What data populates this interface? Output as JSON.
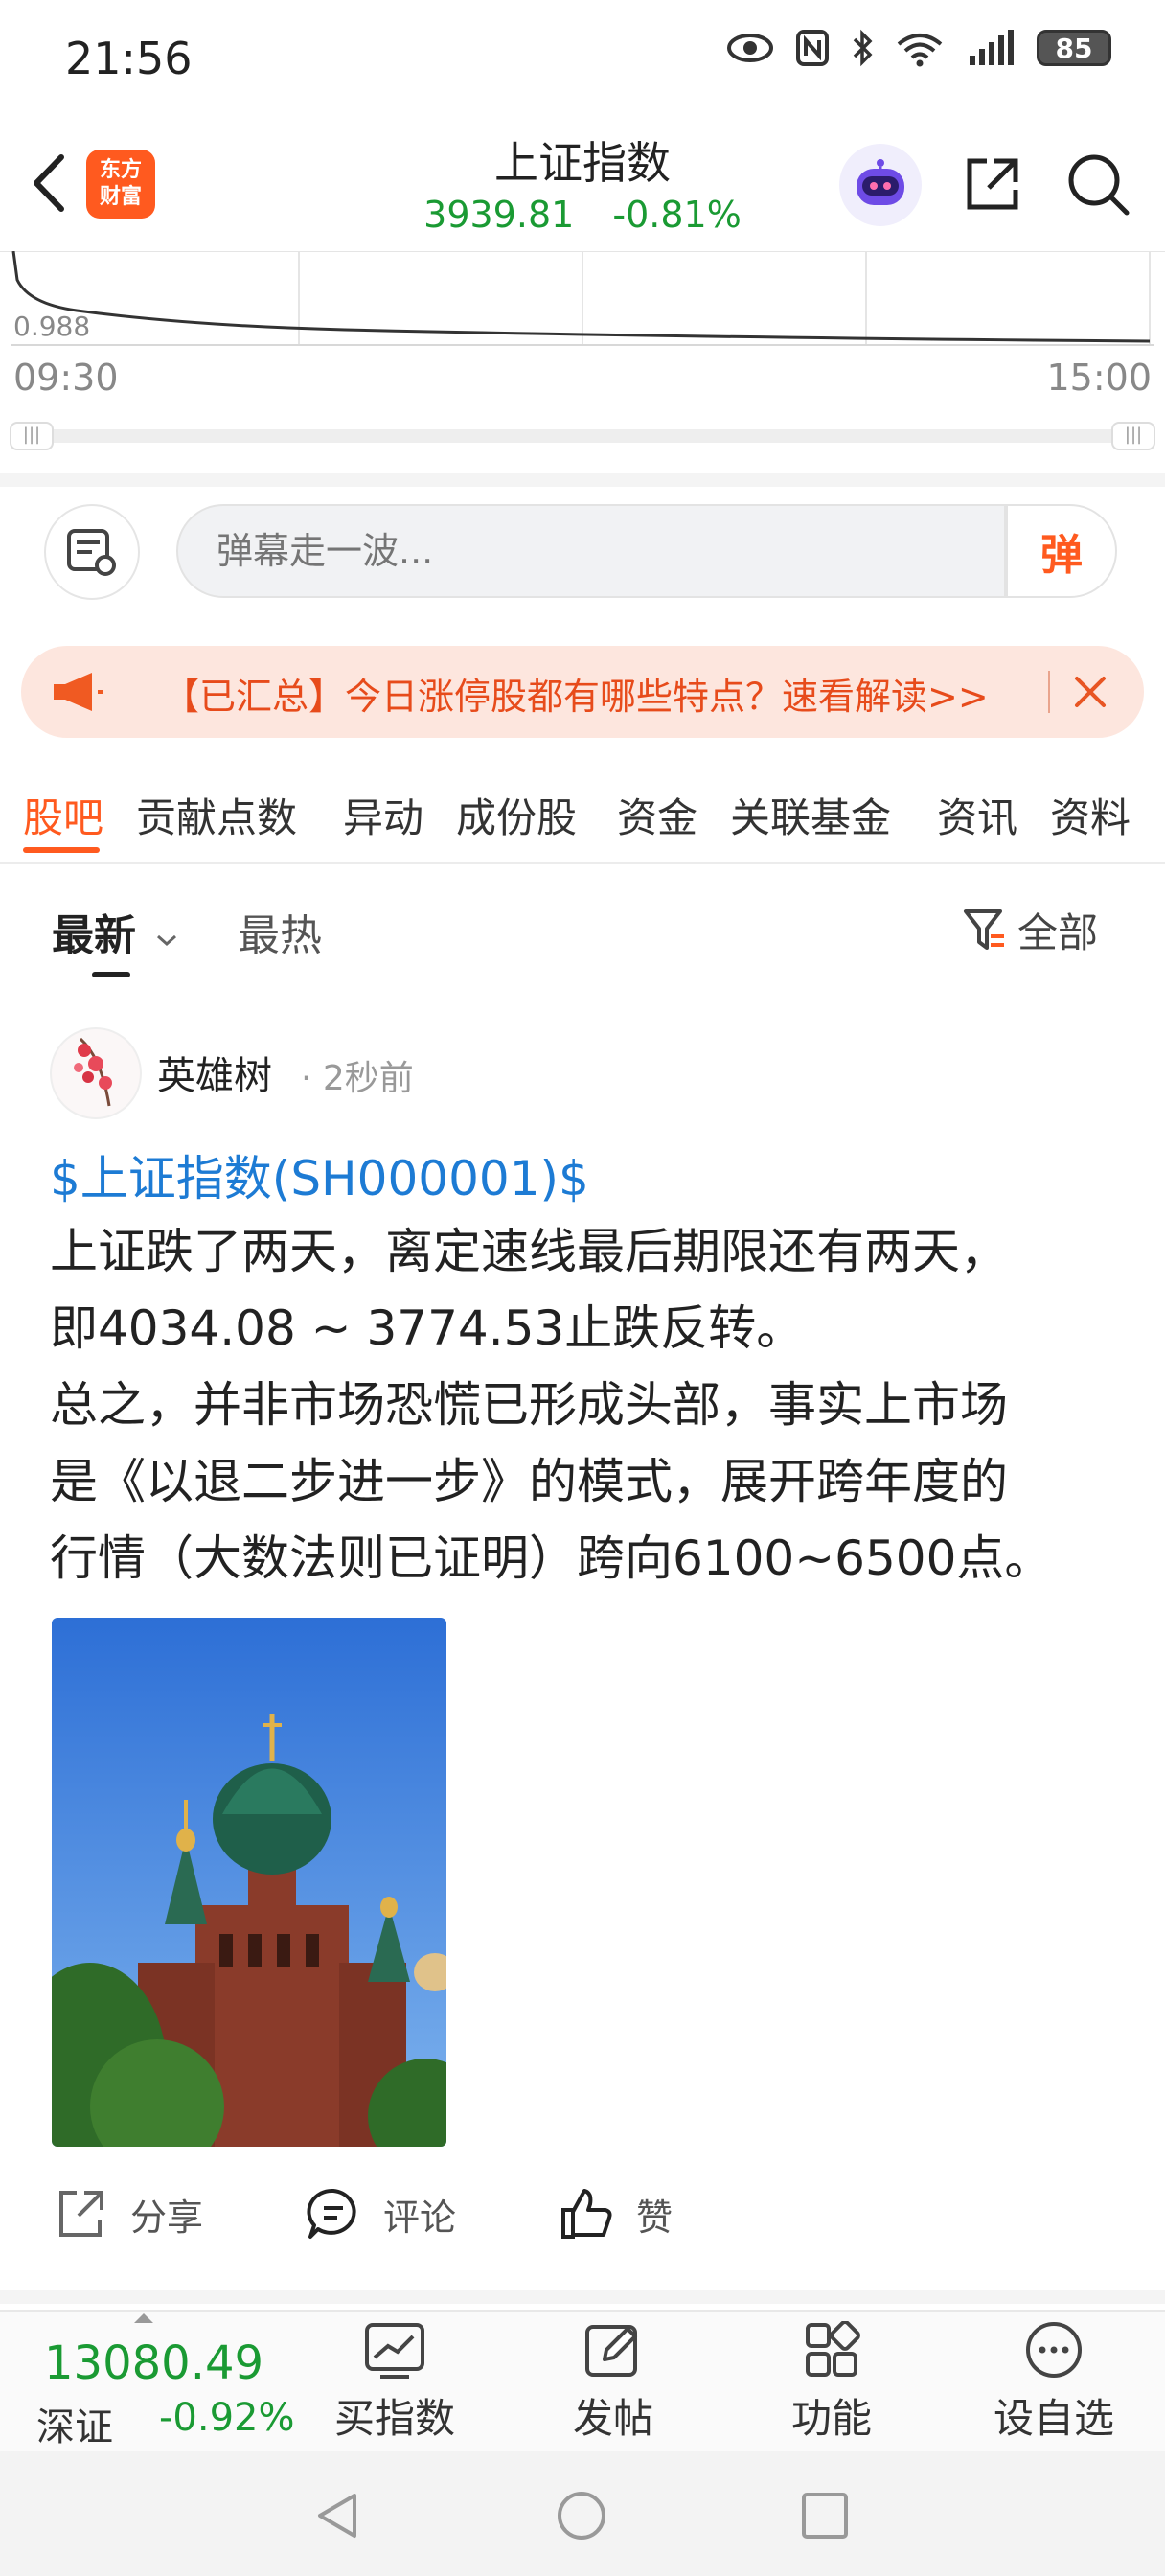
{
  "status_bar": {
    "time": "21:56",
    "battery": "85"
  },
  "header": {
    "logo_line1": "东方",
    "logo_line2": "财富",
    "title": "上证指数",
    "price": "3939.81",
    "change_pct": "-0.81%"
  },
  "chart": {
    "y_label": "0.988",
    "time_start": "09:30",
    "time_end": "15:00"
  },
  "danmu": {
    "placeholder": "弹幕走一波...",
    "send_label": "弹"
  },
  "banner": {
    "text": "【已汇总】今日涨停股都有哪些特点？速看解读>>"
  },
  "tabs": [
    {
      "label": "股吧"
    },
    {
      "label": "贡献点数"
    },
    {
      "label": "异动"
    },
    {
      "label": "成份股"
    },
    {
      "label": "资金"
    },
    {
      "label": "关联基金"
    },
    {
      "label": "资讯"
    },
    {
      "label": "资料"
    }
  ],
  "sort": {
    "latest": "最新",
    "hot": "最热",
    "filter": "全部"
  },
  "post": {
    "username": "英雄树",
    "time": "· 2秒前",
    "stock_link": "$上证指数(SH000001)$",
    "lines": [
      "上证跌了两天，离定速线最后期限还有两天，",
      "即4034.08 ~ 3774.53止跌反转。",
      "总之，并非市场恐慌已形成头部，事实上市场",
      "是《以退二步进一步》的模式，展开跨年度的",
      "行情（大数法则已证明）跨向6100~6500点。"
    ]
  },
  "actions": {
    "share": "分享",
    "comment": "评论",
    "like": "赞"
  },
  "bottom": {
    "index_value": "13080.49",
    "index_name": "深证",
    "index_pct": "-0.92%",
    "nav": [
      {
        "label": "买指数"
      },
      {
        "label": "发帖"
      },
      {
        "label": "功能"
      },
      {
        "label": "设自选"
      }
    ]
  }
}
